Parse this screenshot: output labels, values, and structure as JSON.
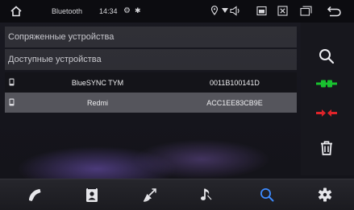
{
  "status_bar": {
    "app_title": "Bluetooth",
    "time": "14:34",
    "bt_glyph": "✱",
    "icons": [
      "home-icon",
      "settings-small-icon",
      "bluetooth-icon",
      "gps-icon",
      "volume-icon",
      "window-icon",
      "close-window-icon",
      "multiwindow-icon",
      "back-icon"
    ]
  },
  "sections": {
    "paired": "Сопряженные устройства",
    "available": "Доступные устройства"
  },
  "devices": [
    {
      "name": "BlueSYNC TYM",
      "mac": "0011B100141D",
      "selected": false
    },
    {
      "name": "Redmi",
      "mac": "ACC1EE83CB9E",
      "selected": true
    }
  ],
  "right_panel": {
    "buttons": [
      "search-icon",
      "connect-icon",
      "disconnect-icon",
      "delete-icon"
    ]
  },
  "bottom_nav": {
    "items": [
      "phone-icon",
      "contacts-icon",
      "call-log-icon",
      "music-icon",
      "search-icon",
      "settings-icon"
    ],
    "active": "search-icon"
  },
  "colors": {
    "accent": "#3d8bff",
    "connect": "#19c22f",
    "disconnect": "#e0242a"
  }
}
